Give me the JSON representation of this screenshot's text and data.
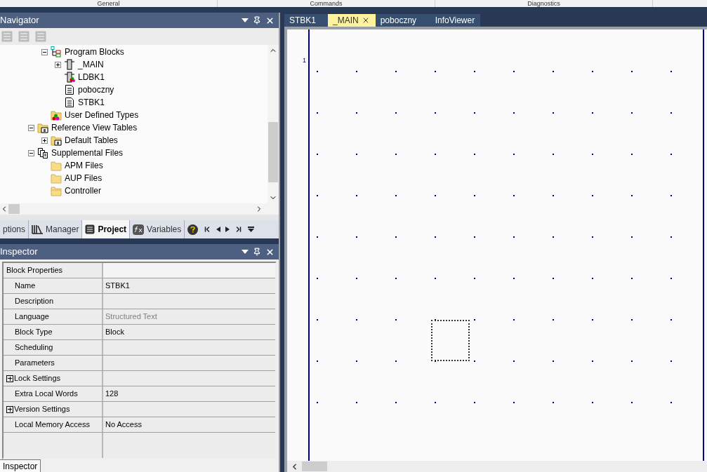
{
  "ribbon_groups": [
    "General",
    "Commands",
    "Diagnostics"
  ],
  "navigator": {
    "title": "Navigator",
    "tree": {
      "nested_items": [
        {
          "label": "Program Blocks",
          "kind": "blocks",
          "expanded": true,
          "children": [
            {
              "label": "_MAIN",
              "kind": "ld",
              "expanded": false
            },
            {
              "label": "LDBK1",
              "kind": "ld-colored"
            },
            {
              "label": "poboczny",
              "kind": "doc"
            },
            {
              "label": "STBK1",
              "kind": "doc"
            }
          ]
        },
        {
          "label": "User Defined Types",
          "kind": "udt"
        }
      ],
      "items": [
        {
          "label": "Reference View Tables",
          "kind": "folder-table",
          "expanded": true,
          "children": [
            {
              "label": "Default Tables",
              "kind": "folder-table",
              "expanded": false
            }
          ]
        },
        {
          "label": "Supplemental Files",
          "kind": "files",
          "expanded": true,
          "children": [
            {
              "label": "APM Files",
              "kind": "folder"
            },
            {
              "label": "AUP Files",
              "kind": "folder"
            },
            {
              "label": "Controller",
              "kind": "folder-open"
            }
          ]
        }
      ]
    },
    "tabs": [
      {
        "label": "ptions",
        "kind": "none",
        "selected": false
      },
      {
        "label": "Manager",
        "kind": "manager",
        "selected": false
      },
      {
        "label": "Project",
        "kind": "project",
        "selected": true
      },
      {
        "label": "Variables",
        "kind": "fx",
        "selected": false
      }
    ]
  },
  "inspector": {
    "title": "Inspector",
    "rows": [
      {
        "name": "Block Properties",
        "value": "",
        "kind": "header"
      },
      {
        "name": "Name",
        "value": "STBK1",
        "kind": "plain",
        "dimmed": false
      },
      {
        "name": "Description",
        "value": "",
        "kind": "plain"
      },
      {
        "name": "Language",
        "value": "Structured Text",
        "kind": "plain",
        "dimmed": true
      },
      {
        "name": "Block Type",
        "value": "Block",
        "kind": "plain",
        "dimmed": false
      },
      {
        "name": "Scheduling",
        "value": "",
        "kind": "plain"
      },
      {
        "name": "Parameters",
        "value": "",
        "kind": "plain"
      },
      {
        "name": "Lock Settings",
        "value": "",
        "kind": "group"
      },
      {
        "name": "Extra Local Words",
        "value": "128",
        "kind": "plain",
        "dimmed": false
      },
      {
        "name": "Version Settings",
        "value": "",
        "kind": "group"
      },
      {
        "name": "Local Memory Access",
        "value": "No Access",
        "kind": "plain",
        "dimmed": false
      }
    ],
    "bottom_tab": "Inspector"
  },
  "editor": {
    "tabs": [
      {
        "label": "STBK1",
        "selected": false,
        "closable": false
      },
      {
        "label": "_MAIN",
        "selected": true,
        "closable": true
      },
      {
        "label": "poboczny",
        "selected": false,
        "closable": false
      },
      {
        "label": "InfoViewer",
        "selected": false,
        "closable": false
      }
    ],
    "rung_number": "1"
  }
}
